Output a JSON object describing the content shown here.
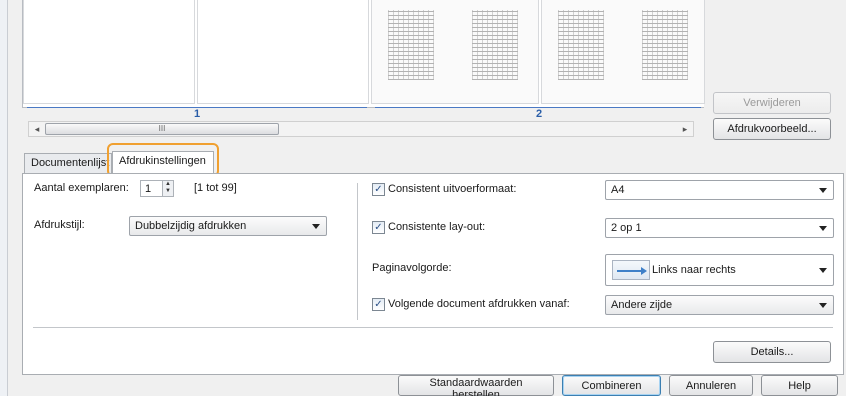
{
  "preview": {
    "sheets": [
      "1",
      "2"
    ],
    "scroll_thumb_label": "III"
  },
  "side_buttons": {
    "remove": "Verwijderen",
    "print_preview": "Afdrukvoorbeeld..."
  },
  "tabs": [
    {
      "label": "Documentenlijst"
    },
    {
      "label": "Afdrukinstellingen",
      "active": true
    }
  ],
  "settings": {
    "copies_label": "Aantal exemplaren:",
    "copies_value": "1",
    "copies_range": "[1 tot 99]",
    "style_label": "Afdrukstijl:",
    "style_value": "Dubbelzijdig afdrukken",
    "consistent_size_label": "Consistent uitvoerformaat:",
    "consistent_size_checked": true,
    "size_value": "A4",
    "consistent_layout_label": "Consistente lay-out:",
    "consistent_layout_checked": true,
    "layout_value": "2 op 1",
    "page_order_label": "Paginavolgorde:",
    "page_order_value": "Links naar rechts",
    "next_doc_label": "Volgende document afdrukken vanaf:",
    "next_doc_checked": true,
    "next_doc_value": "Andere zijde"
  },
  "buttons": {
    "details": "Details...",
    "restore_defaults": "Standaardwaarden herstellen",
    "combine": "Combineren",
    "cancel": "Annuleren",
    "help": "Help"
  },
  "colors": {
    "tab_highlight": "#f0a030",
    "sheet_accent": "#2a5ea8"
  }
}
